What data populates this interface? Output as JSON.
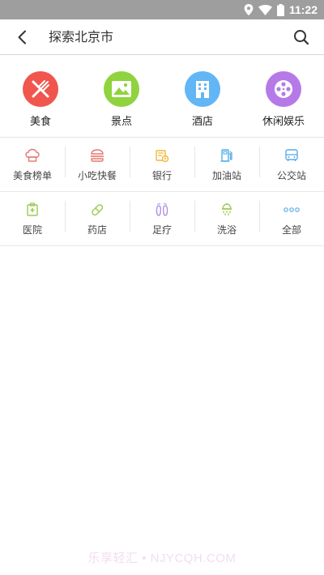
{
  "status_bar": {
    "time": "11:22",
    "icons": [
      "location-icon",
      "wifi-icon",
      "battery-icon"
    ]
  },
  "search": {
    "placeholder": "探索北京市"
  },
  "main_categories": [
    {
      "label": "美食",
      "icon": "fork-knife-icon",
      "color": "#f0564d"
    },
    {
      "label": "景点",
      "icon": "landscape-icon",
      "color": "#8fd33f"
    },
    {
      "label": "酒店",
      "icon": "building-icon",
      "color": "#63b6f5"
    },
    {
      "label": "休闲娱乐",
      "icon": "film-reel-icon",
      "color": "#b67ae8"
    }
  ],
  "sub_categories": [
    {
      "label": "美食榜单",
      "icon": "chef-hat-icon",
      "color": "#e5766e"
    },
    {
      "label": "小吃快餐",
      "icon": "burger-icon",
      "color": "#e5766e"
    },
    {
      "label": "银行",
      "icon": "bank-icon",
      "color": "#f1b83a"
    },
    {
      "label": "加油站",
      "icon": "gas-pump-icon",
      "color": "#57aee8"
    },
    {
      "label": "公交站",
      "icon": "bus-icon",
      "color": "#57aee8"
    },
    {
      "label": "医院",
      "icon": "hospital-icon",
      "color": "#9acb52"
    },
    {
      "label": "药店",
      "icon": "pill-icon",
      "color": "#9acb52"
    },
    {
      "label": "足疗",
      "icon": "footprint-icon",
      "color": "#a88ae0"
    },
    {
      "label": "洗浴",
      "icon": "shower-icon",
      "color": "#9acb52"
    },
    {
      "label": "全部",
      "icon": "more-dots-icon",
      "color": "#57aee8"
    }
  ],
  "watermark": "乐享轻汇 • NJYCQH.COM"
}
